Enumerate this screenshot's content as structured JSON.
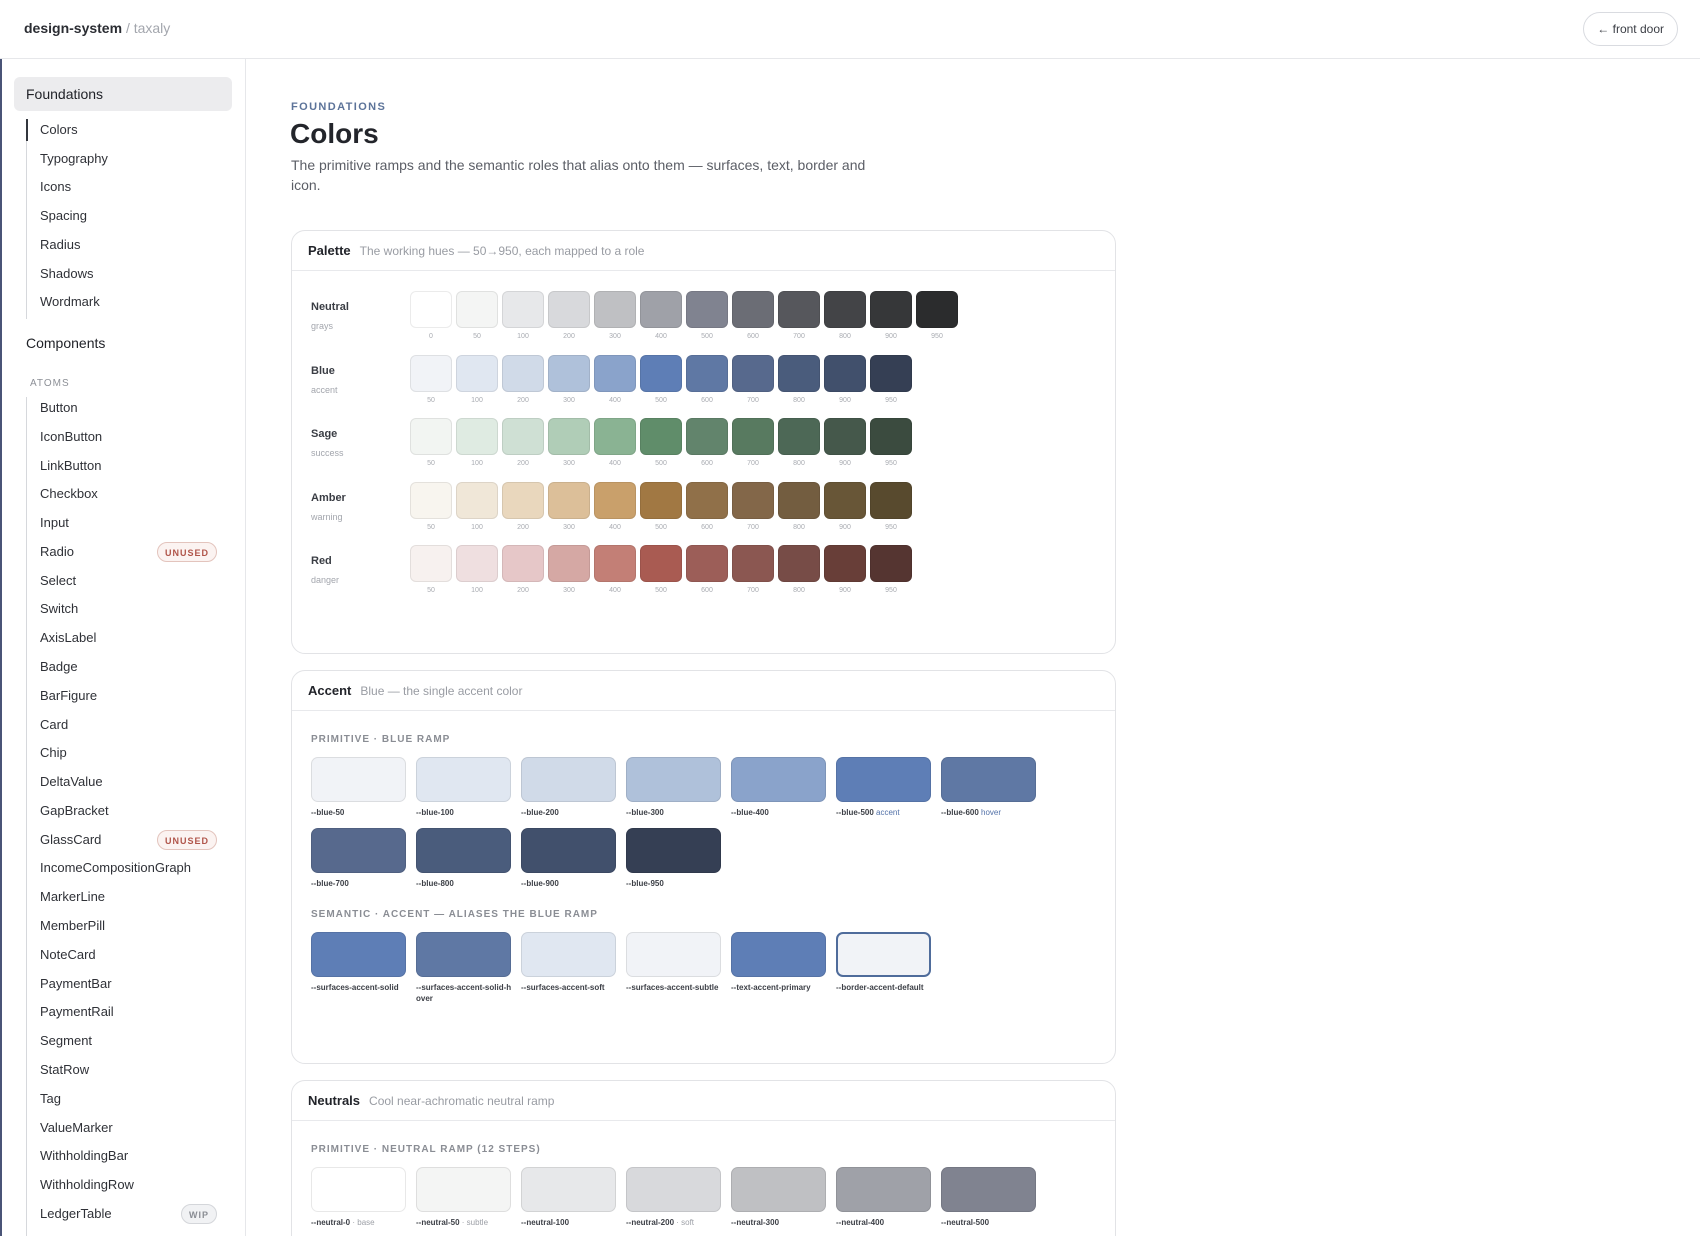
{
  "header": {
    "brand_primary": "design-system",
    "brand_separator": "/",
    "brand_secondary": "taxaly",
    "front_door_label": "← front door"
  },
  "sidebar": {
    "group_label": "Foundations",
    "foundation_items": [
      "Colors",
      "Typography",
      "Icons",
      "Spacing",
      "Radius",
      "Shadows",
      "Wordmark"
    ],
    "components_label": "Components",
    "atoms_label": "ATOMS",
    "atom_items": [
      {
        "label": "Button"
      },
      {
        "label": "IconButton"
      },
      {
        "label": "LinkButton"
      },
      {
        "label": "Checkbox"
      },
      {
        "label": "Input"
      },
      {
        "label": "Radio",
        "badge": "UNUSED"
      },
      {
        "label": "Select"
      },
      {
        "label": "Switch"
      },
      {
        "label": "AxisLabel"
      },
      {
        "label": "Badge"
      },
      {
        "label": "BarFigure"
      },
      {
        "label": "Card"
      },
      {
        "label": "Chip"
      },
      {
        "label": "DeltaValue"
      },
      {
        "label": "GapBracket"
      },
      {
        "label": "GlassCard",
        "badge": "UNUSED"
      },
      {
        "label": "IncomeCompositionGraph"
      },
      {
        "label": "MarkerLine"
      },
      {
        "label": "MemberPill"
      },
      {
        "label": "NoteCard"
      },
      {
        "label": "PaymentBar"
      },
      {
        "label": "PaymentRail"
      },
      {
        "label": "Segment"
      },
      {
        "label": "StatRow"
      },
      {
        "label": "Tag"
      },
      {
        "label": "ValueMarker"
      },
      {
        "label": "WithholdingBar"
      },
      {
        "label": "WithholdingRow"
      },
      {
        "label": "LedgerTable",
        "badge": "WIP"
      }
    ]
  },
  "page": {
    "eyebrow": "FOUNDATIONS",
    "title": "Colors",
    "description": "The primitive ramps and the semantic roles that alias onto them — surfaces, text, border and icon."
  },
  "palette_card": {
    "title": "Palette",
    "subtitle": "The working hues — 50→950, each mapped to a role",
    "ramps": [
      {
        "name": "Neutral",
        "role": "grays",
        "steps": [
          "0",
          "50",
          "100",
          "200",
          "300",
          "400",
          "500",
          "600",
          "700",
          "800",
          "900",
          "950"
        ],
        "colors": [
          "#ffffff",
          "#f4f5f4",
          "#e7e8ea",
          "#d8d9dc",
          "#bfc0c3",
          "#9fa1a8",
          "#808390",
          "#6b6d75",
          "#56575c",
          "#434447",
          "#363739",
          "#2b2c2d"
        ]
      },
      {
        "name": "Blue",
        "role": "accent",
        "steps": [
          "50",
          "100",
          "200",
          "300",
          "400",
          "500",
          "600",
          "700",
          "800",
          "900",
          "950"
        ],
        "colors": [
          "#f1f3f7",
          "#e0e7f1",
          "#d0dae8",
          "#afc1da",
          "#8aa3cb",
          "#5e7eb6",
          "#5f78a4",
          "#57698d",
          "#4a5c7c",
          "#41506c",
          "#353f54"
        ]
      },
      {
        "name": "Sage",
        "role": "success",
        "steps": [
          "50",
          "100",
          "200",
          "300",
          "400",
          "500",
          "600",
          "700",
          "800",
          "900",
          "950"
        ],
        "colors": [
          "#f2f5f2",
          "#dfebe2",
          "#cfe0d4",
          "#b0cdb7",
          "#8ab393",
          "#608d6a",
          "#62846c",
          "#587a60",
          "#4d6856",
          "#45584b",
          "#3b4b3f"
        ]
      },
      {
        "name": "Amber",
        "role": "warning",
        "steps": [
          "50",
          "100",
          "200",
          "300",
          "400",
          "500",
          "600",
          "700",
          "800",
          "900",
          "950"
        ],
        "colors": [
          "#f8f5ef",
          "#f0e7d8",
          "#e9d7bd",
          "#dcbf99",
          "#c9a06b",
          "#a17843",
          "#907049",
          "#836749",
          "#735d40",
          "#685637",
          "#584a2e"
        ]
      },
      {
        "name": "Red",
        "role": "danger",
        "steps": [
          "50",
          "100",
          "200",
          "300",
          "400",
          "500",
          "600",
          "700",
          "800",
          "900",
          "950"
        ],
        "colors": [
          "#f7f1ef",
          "#efdfe0",
          "#e6c7c8",
          "#d5a8a4",
          "#c37f76",
          "#a95b52",
          "#9c5e58",
          "#8b5751",
          "#774c47",
          "#683e38",
          "#553531"
        ]
      }
    ]
  },
  "accent_card": {
    "title": "Accent",
    "subtitle": "Blue — the single accent color",
    "primitive_heading": "PRIMITIVE · BLUE RAMP",
    "primitive_tiles": [
      {
        "token": "--blue-50",
        "role": "",
        "color": "#f1f3f7"
      },
      {
        "token": "--blue-100",
        "role": "",
        "color": "#e0e7f1"
      },
      {
        "token": "--blue-200",
        "role": "",
        "color": "#d0dae8"
      },
      {
        "token": "--blue-300",
        "role": "",
        "color": "#afc1da"
      },
      {
        "token": "--blue-400",
        "role": "",
        "color": "#8aa3cb"
      },
      {
        "token": "--blue-500",
        "role": "accent",
        "color": "#5e7eb6"
      },
      {
        "token": "--blue-600",
        "role": "hover",
        "color": "#5f78a4"
      },
      {
        "token": "--blue-700",
        "role": "",
        "color": "#57698d"
      },
      {
        "token": "--blue-800",
        "role": "",
        "color": "#4a5c7c"
      },
      {
        "token": "--blue-900",
        "role": "",
        "color": "#41506c"
      },
      {
        "token": "--blue-950",
        "role": "",
        "color": "#353f54"
      }
    ],
    "semantic_heading": "SEMANTIC · ACCENT — ALIASES THE BLUE RAMP",
    "semantic_tiles": [
      {
        "token": "--surfaces-accent-solid",
        "color": "#5e7eb6"
      },
      {
        "token": "--surfaces-accent-solid-hover",
        "color": "#5f78a4"
      },
      {
        "token": "--surfaces-accent-soft",
        "color": "#e0e7f1"
      },
      {
        "token": "--surfaces-accent-subtle",
        "color": "#f1f3f7"
      },
      {
        "token": "--text-accent-primary",
        "color": "#5e7eb6"
      },
      {
        "token": "--border-accent-default",
        "color": "#f1f3f7"
      }
    ]
  },
  "neutrals_card": {
    "title": "Neutrals",
    "subtitle": "Cool near-achromatic neutral ramp",
    "primitive_heading": "PRIMITIVE · NEUTRAL RAMP (12 STEPS)",
    "tiles": [
      {
        "token": "--neutral-0",
        "note": "· base",
        "color": "#ffffff"
      },
      {
        "token": "--neutral-50",
        "note": "· subtle",
        "color": "#f4f5f4"
      },
      {
        "token": "--neutral-100",
        "note": "",
        "color": "#e7e8ea"
      },
      {
        "token": "--neutral-200",
        "note": "· soft",
        "color": "#d8d9dc"
      },
      {
        "token": "--neutral-300",
        "note": "",
        "color": "#bfc0c3"
      },
      {
        "token": "--neutral-400",
        "note": "",
        "color": "#9fa1a8"
      },
      {
        "token": "--neutral-500",
        "note": "",
        "color": "#808390"
      }
    ]
  }
}
